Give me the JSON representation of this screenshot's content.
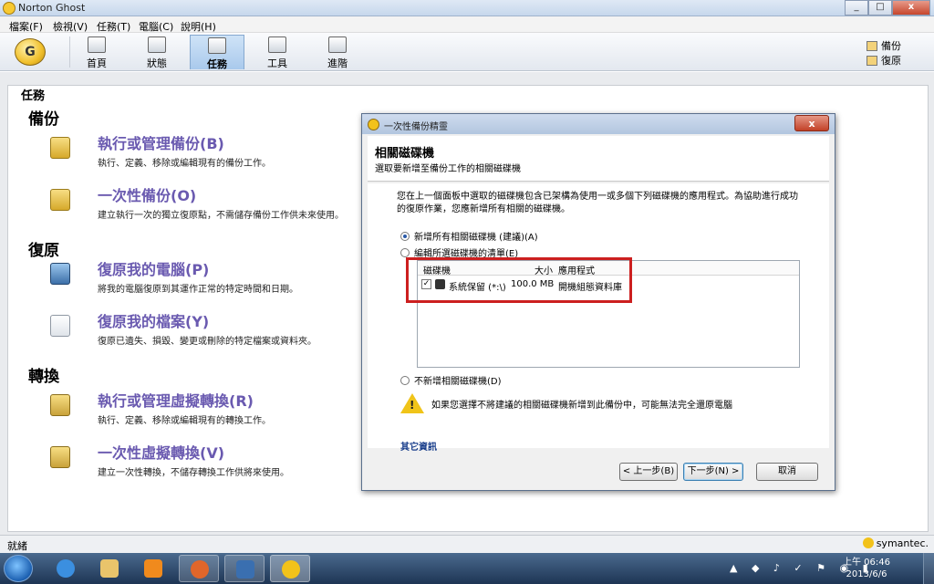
{
  "window": {
    "title": "Norton Ghost",
    "controls": [
      "_",
      "□",
      "x"
    ]
  },
  "menu": [
    "檔案(F)",
    "檢視(V)",
    "任務(T)",
    "電腦(C)",
    "說明(H)"
  ],
  "toolbar": {
    "tools": [
      {
        "label": "首頁",
        "icon": "home-icon"
      },
      {
        "label": "狀態",
        "icon": "status-icon"
      },
      {
        "label": "任務",
        "icon": "tasks-icon",
        "active": true
      },
      {
        "label": "工具",
        "icon": "tools-icon"
      },
      {
        "label": "進階",
        "icon": "advanced-icon"
      }
    ],
    "quick_links": [
      "備份",
      "復原"
    ]
  },
  "page": {
    "heading": "任務",
    "sections": [
      {
        "title": "備份",
        "tasks": [
          {
            "title": "執行或管理備份(B)",
            "desc": "執行、定義、移除或編輯現有的備份工作。"
          },
          {
            "title": "一次性備份(O)",
            "desc": "建立執行一次的獨立復原點，不需儲存備份工作供未來使用。"
          }
        ]
      },
      {
        "title": "復原",
        "tasks": [
          {
            "title": "復原我的電腦(P)",
            "desc": "將我的電腦復原到其運作正常的特定時間和日期。"
          },
          {
            "title": "復原我的檔案(Y)",
            "desc": "復原已遺失、損毀、變更或刪除的特定檔案或資料夾。"
          }
        ]
      },
      {
        "title": "轉換",
        "tasks": [
          {
            "title": "執行或管理虛擬轉換(R)",
            "desc": "執行、定義、移除或編輯現有的轉換工作。"
          },
          {
            "title": "一次性虛擬轉換(V)",
            "desc": "建立一次性轉換，不儲存轉換工作供將來使用。"
          }
        ]
      }
    ]
  },
  "status": {
    "text": "就緒",
    "brand": "symantec."
  },
  "dialog": {
    "title": "一次性備份精靈",
    "close": "x",
    "header_title": "相關磁碟機",
    "header_subtitle": "選取要新增至備份工作的相關磁碟機",
    "intro": "您在上一個面板中選取的磁碟機包含已架構為使用一或多個下列磁碟機的應用程式。為協助進行成功的復原作業，您應新增所有相關的磁碟機。",
    "options": [
      {
        "label": "新增所有相關磁碟機 (建議)(A)",
        "selected": true
      },
      {
        "label": "編輯所選磁碟機的清單(E)",
        "selected": false
      },
      {
        "label": "不新增相關磁碟機(D)",
        "selected": false
      }
    ],
    "list": {
      "columns": [
        "磁碟機",
        "大小",
        "應用程式"
      ],
      "rows": [
        {
          "checked": "✓",
          "drive": "系統保留 (*:\\)",
          "size": "100.0 MB",
          "app": "開機組態資料庫"
        }
      ]
    },
    "warning": "如果您選擇不將建議的相關磁碟機新增到此備份中，可能無法完全還原電腦",
    "more_info": "其它資訊",
    "buttons": {
      "back": "< 上一步(B)",
      "next": "下一步(N) >",
      "cancel": "取消"
    }
  },
  "taskbar": {
    "time": "上午 06:46",
    "date": "2013/6/6"
  },
  "colors": {
    "task_title": "#6a5ab0",
    "highlight_box": "#cc1f1f",
    "link": "#1a3f8c"
  }
}
